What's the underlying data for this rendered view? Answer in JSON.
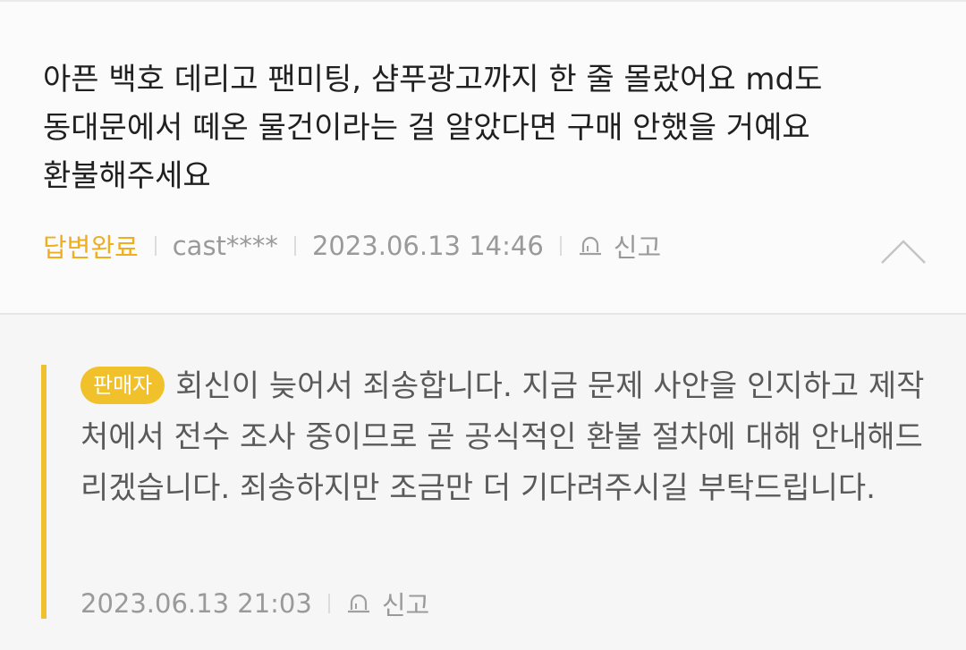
{
  "question": {
    "text": "아픈 백호 데리고 팬미팅, 샴푸광고까지 한 줄 몰랐어요 md도\n동대문에서 떼온 물건이라는 걸 알았다면 구매 안했을 거예요\n환불해주세요",
    "status": "답변완료",
    "author": "cast****",
    "datetime": "2023.06.13 14:46",
    "report_label": "신고"
  },
  "answer": {
    "badge": "판매자",
    "text": "회신이 늦어서 죄송합니다. 지금 문제 사안을 인지하고 제작처에서 전수 조사 중이므로 곧 공식적인 환불 절차에 대해 안내해드리겠습니다. 죄송하지만 조금만 더 기다려주시길 부탁드립니다.",
    "datetime": "2023.06.13 21:03",
    "report_label": "신고"
  },
  "icons": {
    "report": "siren-icon",
    "collapse": "chevron-up-icon"
  },
  "colors": {
    "accent": "#f0ae1e",
    "badge": "#f1c12b",
    "answer_bar": "#efc12f"
  }
}
